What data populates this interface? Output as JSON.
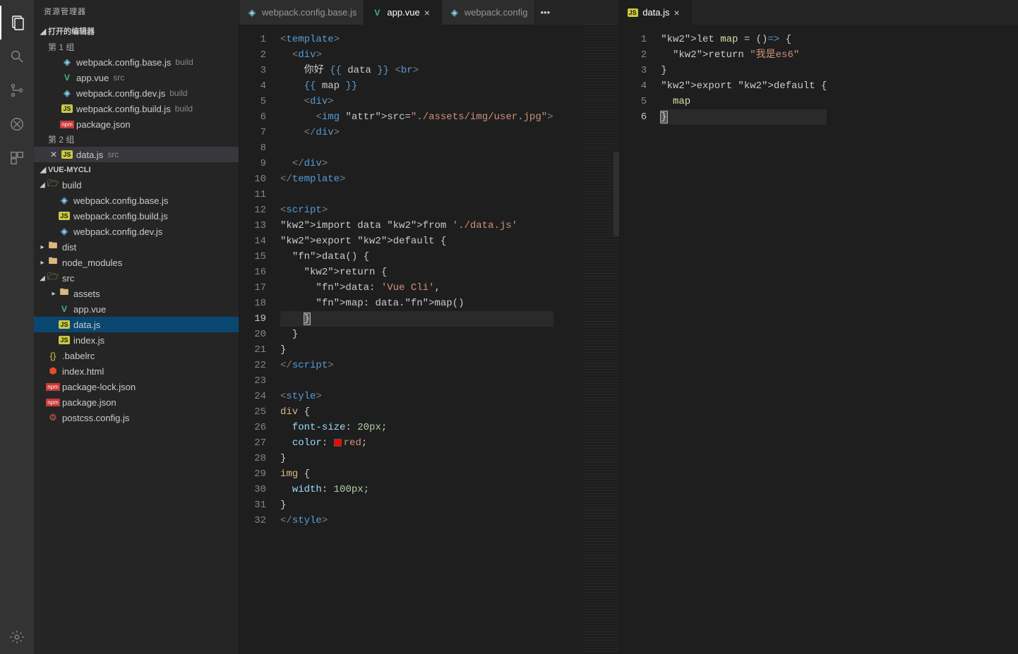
{
  "sidebar": {
    "title": "资源管理器",
    "openEditorsHeader": "打开的编辑器",
    "group1": "第 1 组",
    "group2": "第 2 组",
    "projectHeader": "VUE-MYCLI",
    "openEditors": {
      "g1": [
        {
          "label": "webpack.config.base.js",
          "meta": "build",
          "icon": "webpack"
        },
        {
          "label": "app.vue",
          "meta": "src",
          "icon": "vue"
        },
        {
          "label": "webpack.config.dev.js",
          "meta": "build",
          "icon": "webpack"
        },
        {
          "label": "webpack.config.build.js",
          "meta": "build",
          "icon": "js"
        },
        {
          "label": "package.json",
          "meta": "",
          "icon": "npm"
        }
      ],
      "g2": [
        {
          "label": "data.js",
          "meta": "src",
          "icon": "js"
        }
      ]
    },
    "tree": {
      "build": {
        "label": "build",
        "children": [
          {
            "label": "webpack.config.base.js",
            "icon": "webpack"
          },
          {
            "label": "webpack.config.build.js",
            "icon": "js"
          },
          {
            "label": "webpack.config.dev.js",
            "icon": "webpack"
          }
        ]
      },
      "dist": {
        "label": "dist"
      },
      "node_modules": {
        "label": "node_modules"
      },
      "src": {
        "label": "src",
        "children": [
          {
            "label": "assets",
            "icon": "folder"
          },
          {
            "label": "app.vue",
            "icon": "vue"
          },
          {
            "label": "data.js",
            "icon": "js"
          },
          {
            "label": "index.js",
            "icon": "js"
          }
        ]
      },
      "rootFiles": [
        {
          "label": ".babelrc",
          "icon": "json"
        },
        {
          "label": "index.html",
          "icon": "html5"
        },
        {
          "label": "package-lock.json",
          "icon": "npm"
        },
        {
          "label": "package.json",
          "icon": "npm"
        },
        {
          "label": "postcss.config.js",
          "icon": "cfg"
        }
      ]
    }
  },
  "tabsLeft": [
    {
      "label": "webpack.config.base.js",
      "icon": "webpack",
      "active": false
    },
    {
      "label": "app.vue",
      "icon": "vue",
      "active": true
    },
    {
      "label": "webpack.config",
      "icon": "webpack",
      "active": false
    }
  ],
  "tabsRight": [
    {
      "label": "data.js",
      "icon": "js",
      "active": true
    }
  ],
  "leftEditor": {
    "fileName": "app.vue",
    "activeLine": 19,
    "lines": [
      "<template>",
      "  <div>",
      "    你好 {{ data }} <br>",
      "    {{ map }}",
      "    <div>",
      "      <img src=\"./assets/img/user.jpg\">",
      "    </div>",
      "",
      "  </div>",
      "</template>",
      "",
      "<script>",
      "import data from './data.js'",
      "export default {",
      "  data() {",
      "    return {",
      "      data: 'Vue Cli',",
      "      map: data.map()",
      "    }",
      "  }",
      "}",
      "</script>",
      "",
      "<style>",
      "div {",
      "  font-size: 20px;",
      "  color: red;",
      "}",
      "img {",
      "  width: 100px;",
      "}",
      "</style>"
    ]
  },
  "rightEditor": {
    "fileName": "data.js",
    "activeLine": 6,
    "lines": [
      "let map = ()=> {",
      "  return \"我是es6\"",
      "}",
      "export default {",
      "  map",
      "}"
    ]
  }
}
